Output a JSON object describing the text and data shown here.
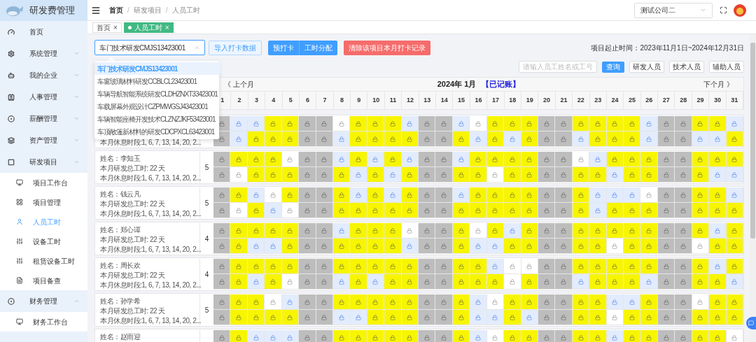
{
  "sidebar": {
    "title": "研发费管理",
    "items": [
      {
        "label": "首页",
        "kind": "link"
      },
      {
        "label": "系统管理",
        "kind": "group",
        "expanded": false
      },
      {
        "label": "我的企业",
        "kind": "group",
        "expanded": false
      },
      {
        "label": "人事管理",
        "kind": "group",
        "expanded": false
      },
      {
        "label": "薪酬管理",
        "kind": "group",
        "expanded": false
      },
      {
        "label": "资产管理",
        "kind": "group",
        "expanded": false
      },
      {
        "label": "研发项目",
        "kind": "group",
        "expanded": true,
        "children": [
          {
            "label": "项目工作台",
            "selected": false
          },
          {
            "label": "项目管理",
            "selected": false
          },
          {
            "label": "人员工时",
            "selected": true
          },
          {
            "label": "设备工时",
            "selected": false
          },
          {
            "label": "租赁设备工时",
            "selected": false
          },
          {
            "label": "项目备查",
            "selected": false
          }
        ]
      },
      {
        "label": "财务管理",
        "kind": "group",
        "expanded": true,
        "children": [
          {
            "label": "财务工作台",
            "selected": false
          }
        ]
      }
    ]
  },
  "header": {
    "breadcrumb": [
      "首页",
      "研发项目",
      "人员工时"
    ],
    "separators": [
      "/",
      "/"
    ],
    "company": "测试公司二"
  },
  "tabs": [
    {
      "label": "首页",
      "close": "×",
      "selected": false
    },
    {
      "label": "人员工时",
      "close": "×",
      "selected": true
    }
  ],
  "toolbar": {
    "project": "车门技术研发CMJS13423001",
    "buttons": [
      {
        "label": "导入打卡数据",
        "kind": "outline"
      },
      {
        "label": "预打卡",
        "kind": "primary"
      },
      {
        "label": "工时分配",
        "kind": "primary"
      },
      {
        "label": "清除该项目本月打卡记录",
        "kind": "danger"
      }
    ],
    "period": "项目起止时间：2023年11月1日~2024年12月31日"
  },
  "dropdown": {
    "options": [
      {
        "label": "车门技术研发CMJS13423001",
        "selected": true
      },
      {
        "label": "车窗玻璃材料研发CCBLCL23423001",
        "selected": false
      },
      {
        "label": "车辆导航智能系统研发CLDHZNXT33423001",
        "selected": false
      },
      {
        "label": "车载屏幕外观设计CZPMWGSJ43423001",
        "selected": false
      },
      {
        "label": "车辆智能座椅开发技术CLZNZJKF53423001",
        "selected": false
      },
      {
        "label": "车顶敞篷新材料的研发CDCPXCL63423001",
        "selected": false
      }
    ]
  },
  "search": {
    "placeholder": "请输入员工姓名或工号",
    "button": "查询",
    "filters": [
      "研发人员",
      "技术人员",
      "辅助人员"
    ]
  },
  "calendar": {
    "prev": "《 上个月",
    "title": "2024年 1月",
    "status": "【已记账】",
    "next": "下个月 》",
    "days": [
      "1",
      "2",
      "3",
      "4",
      "5",
      "6",
      "7",
      "8",
      "9",
      "10",
      "11",
      "12",
      "13",
      "14",
      "15",
      "16",
      "17",
      "18",
      "19",
      "20",
      "21",
      "22",
      "23",
      "24",
      "25",
      "26",
      "27",
      "28",
      "29",
      "30",
      "31"
    ]
  },
  "employees": [
    {
      "rest": "本月休息时段:1, 6, 7, 13, 14, 20, 2...",
      "day_rows": [
        [
          {
            "kind": "rest"
          },
          {
            "kind": "open"
          },
          {
            "kind": "open"
          },
          {
            "kind": "work"
          },
          {
            "kind": "work"
          },
          {
            "kind": "rest"
          },
          {
            "kind": "rest"
          },
          {
            "kind": "empty"
          },
          {
            "kind": "work"
          },
          {
            "kind": "work"
          },
          {
            "kind": "work"
          },
          {
            "kind": "open"
          },
          {
            "kind": "rest"
          },
          {
            "kind": "rest"
          },
          {
            "kind": "open"
          },
          {
            "kind": "empty"
          },
          {
            "kind": "work"
          },
          {
            "kind": "work"
          },
          {
            "kind": "work"
          },
          {
            "kind": "rest"
          },
          {
            "kind": "rest"
          },
          {
            "kind": "work"
          },
          {
            "kind": "work"
          },
          {
            "kind": "work"
          },
          {
            "kind": "work"
          },
          {
            "kind": "open"
          },
          {
            "kind": "rest"
          },
          {
            "kind": "rest"
          },
          {
            "kind": "work"
          },
          {
            "kind": "work"
          },
          {
            "kind": "open"
          }
        ],
        [
          {
            "kind": "rest"
          },
          {
            "kind": "open"
          },
          {
            "kind": "work"
          },
          {
            "kind": "work"
          },
          {
            "kind": "work"
          },
          {
            "kind": "rest"
          },
          {
            "kind": "rest"
          },
          {
            "kind": "open"
          },
          {
            "kind": "work"
          },
          {
            "kind": "work"
          },
          {
            "kind": "work"
          },
          {
            "kind": "work"
          },
          {
            "kind": "rest"
          },
          {
            "kind": "rest"
          },
          {
            "kind": "work"
          },
          {
            "kind": "open"
          },
          {
            "kind": "work"
          },
          {
            "kind": "open"
          },
          {
            "kind": "work"
          },
          {
            "kind": "rest"
          },
          {
            "kind": "rest"
          },
          {
            "kind": "open"
          },
          {
            "kind": "work"
          },
          {
            "kind": "work"
          },
          {
            "kind": "work"
          },
          {
            "kind": "open"
          },
          {
            "kind": "rest"
          },
          {
            "kind": "rest"
          },
          {
            "kind": "open"
          },
          {
            "kind": "open"
          },
          {
            "kind": "work"
          }
        ]
      ]
    },
    {
      "name": "姓名：李知玉",
      "hours": "本月研发总工时: 22 天",
      "rest": "本月休息时段:1, 6, 7, 13, 14, 20, 2...",
      "count": "5",
      "day_rows": [
        [
          {
            "kind": "rest"
          },
          {
            "kind": "work"
          },
          {
            "kind": "work"
          },
          {
            "kind": "work"
          },
          {
            "kind": "empty"
          },
          {
            "kind": "rest"
          },
          {
            "kind": "rest"
          },
          {
            "kind": "open"
          },
          {
            "kind": "work"
          },
          {
            "kind": "open"
          },
          {
            "kind": "work"
          },
          {
            "kind": "open"
          },
          {
            "kind": "rest"
          },
          {
            "kind": "rest"
          },
          {
            "kind": "open"
          },
          {
            "kind": "work"
          },
          {
            "kind": "work"
          },
          {
            "kind": "work"
          },
          {
            "kind": "work"
          },
          {
            "kind": "rest"
          },
          {
            "kind": "rest"
          },
          {
            "kind": "empty"
          },
          {
            "kind": "open"
          },
          {
            "kind": "work"
          },
          {
            "kind": "work"
          },
          {
            "kind": "work"
          },
          {
            "kind": "rest"
          },
          {
            "kind": "rest"
          },
          {
            "kind": "work"
          },
          {
            "kind": "work"
          },
          {
            "kind": "work"
          }
        ],
        [
          {
            "kind": "rest"
          },
          {
            "kind": "empty"
          },
          {
            "kind": "work"
          },
          {
            "kind": "work"
          },
          {
            "kind": "work"
          },
          {
            "kind": "rest"
          },
          {
            "kind": "rest"
          },
          {
            "kind": "work"
          },
          {
            "kind": "open"
          },
          {
            "kind": "work"
          },
          {
            "kind": "open"
          },
          {
            "kind": "work"
          },
          {
            "kind": "rest"
          },
          {
            "kind": "rest"
          },
          {
            "kind": "work"
          },
          {
            "kind": "work"
          },
          {
            "kind": "empty"
          },
          {
            "kind": "work"
          },
          {
            "kind": "work"
          },
          {
            "kind": "rest"
          },
          {
            "kind": "rest"
          },
          {
            "kind": "work"
          },
          {
            "kind": "work"
          },
          {
            "kind": "open"
          },
          {
            "kind": "work"
          },
          {
            "kind": "work"
          },
          {
            "kind": "rest"
          },
          {
            "kind": "rest"
          },
          {
            "kind": "work"
          },
          {
            "kind": "open"
          },
          {
            "kind": "open"
          }
        ]
      ]
    },
    {
      "name": "姓名：钱云凡",
      "hours": "本月研发总工时: 22 天",
      "rest": "本月休息时段:1, 6, 7, 13, 14, 20, 2...",
      "count": "5",
      "day_rows": [
        [
          {
            "kind": "rest"
          },
          {
            "kind": "work"
          },
          {
            "kind": "open"
          },
          {
            "kind": "empty"
          },
          {
            "kind": "work"
          },
          {
            "kind": "rest"
          },
          {
            "kind": "rest"
          },
          {
            "kind": "work"
          },
          {
            "kind": "open"
          },
          {
            "kind": "work"
          },
          {
            "kind": "open"
          },
          {
            "kind": "work"
          },
          {
            "kind": "rest"
          },
          {
            "kind": "rest"
          },
          {
            "kind": "open"
          },
          {
            "kind": "work"
          },
          {
            "kind": "work"
          },
          {
            "kind": "work"
          },
          {
            "kind": "work"
          },
          {
            "kind": "rest"
          },
          {
            "kind": "rest"
          },
          {
            "kind": "work"
          },
          {
            "kind": "open"
          },
          {
            "kind": "open"
          },
          {
            "kind": "open"
          },
          {
            "kind": "empty"
          },
          {
            "kind": "rest"
          },
          {
            "kind": "rest"
          },
          {
            "kind": "work"
          },
          {
            "kind": "work"
          },
          {
            "kind": "open"
          }
        ],
        [
          {
            "kind": "rest"
          },
          {
            "kind": "empty"
          },
          {
            "kind": "work"
          },
          {
            "kind": "open"
          },
          {
            "kind": "empty"
          },
          {
            "kind": "rest"
          },
          {
            "kind": "rest"
          },
          {
            "kind": "work"
          },
          {
            "kind": "work"
          },
          {
            "kind": "work"
          },
          {
            "kind": "work"
          },
          {
            "kind": "work"
          },
          {
            "kind": "rest"
          },
          {
            "kind": "rest"
          },
          {
            "kind": "work"
          },
          {
            "kind": "work"
          },
          {
            "kind": "work"
          },
          {
            "kind": "work"
          },
          {
            "kind": "work"
          },
          {
            "kind": "rest"
          },
          {
            "kind": "rest"
          },
          {
            "kind": "work"
          },
          {
            "kind": "open"
          },
          {
            "kind": "work"
          },
          {
            "kind": "work"
          },
          {
            "kind": "work"
          },
          {
            "kind": "rest"
          },
          {
            "kind": "rest"
          },
          {
            "kind": "work"
          },
          {
            "kind": "work"
          },
          {
            "kind": "work"
          }
        ]
      ]
    },
    {
      "name": "姓名：郑心谭",
      "hours": "本月研发总工时: 22 天",
      "rest": "本月休息时段:1, 6, 7, 13, 14, 20, 2...",
      "count": "4",
      "day_rows": [
        [
          {
            "kind": "rest"
          },
          {
            "kind": "work"
          },
          {
            "kind": "work"
          },
          {
            "kind": "work"
          },
          {
            "kind": "work"
          },
          {
            "kind": "rest"
          },
          {
            "kind": "rest"
          },
          {
            "kind": "open"
          },
          {
            "kind": "work"
          },
          {
            "kind": "work"
          },
          {
            "kind": "work"
          },
          {
            "kind": "empty"
          },
          {
            "kind": "rest"
          },
          {
            "kind": "rest"
          },
          {
            "kind": "work"
          },
          {
            "kind": "empty"
          },
          {
            "kind": "work"
          },
          {
            "kind": "open"
          },
          {
            "kind": "work"
          },
          {
            "kind": "rest"
          },
          {
            "kind": "rest"
          },
          {
            "kind": "work"
          },
          {
            "kind": "work"
          },
          {
            "kind": "work"
          },
          {
            "kind": "work"
          },
          {
            "kind": "work"
          },
          {
            "kind": "rest"
          },
          {
            "kind": "rest"
          },
          {
            "kind": "work"
          },
          {
            "kind": "open"
          },
          {
            "kind": "work"
          }
        ],
        [
          {
            "kind": "rest"
          },
          {
            "kind": "work"
          },
          {
            "kind": "open"
          },
          {
            "kind": "open"
          },
          {
            "kind": "work"
          },
          {
            "kind": "rest"
          },
          {
            "kind": "rest"
          },
          {
            "kind": "work"
          },
          {
            "kind": "work"
          },
          {
            "kind": "work"
          },
          {
            "kind": "work"
          },
          {
            "kind": "open"
          },
          {
            "kind": "rest"
          },
          {
            "kind": "rest"
          },
          {
            "kind": "work"
          },
          {
            "kind": "open"
          },
          {
            "kind": "open"
          },
          {
            "kind": "work"
          },
          {
            "kind": "work"
          },
          {
            "kind": "rest"
          },
          {
            "kind": "rest"
          },
          {
            "kind": "work"
          },
          {
            "kind": "work"
          },
          {
            "kind": "empty"
          },
          {
            "kind": "work"
          },
          {
            "kind": "work"
          },
          {
            "kind": "rest"
          },
          {
            "kind": "rest"
          },
          {
            "kind": "empty"
          },
          {
            "kind": "work"
          },
          {
            "kind": "work"
          }
        ]
      ]
    },
    {
      "name": "姓名：周长欢",
      "hours": "本月研发总工时: 22 天",
      "rest": "本月休息时段:1, 6, 7, 13, 14, 20, 2...",
      "count": "4",
      "day_rows": [
        [
          {
            "kind": "rest"
          },
          {
            "kind": "work"
          },
          {
            "kind": "work"
          },
          {
            "kind": "work"
          },
          {
            "kind": "work"
          },
          {
            "kind": "rest"
          },
          {
            "kind": "rest"
          },
          {
            "kind": "work"
          },
          {
            "kind": "work"
          },
          {
            "kind": "work"
          },
          {
            "kind": "work"
          },
          {
            "kind": "work"
          },
          {
            "kind": "rest"
          },
          {
            "kind": "rest"
          },
          {
            "kind": "work"
          },
          {
            "kind": "work"
          },
          {
            "kind": "open"
          },
          {
            "kind": "empty"
          },
          {
            "kind": "empty"
          },
          {
            "kind": "rest"
          },
          {
            "kind": "rest"
          },
          {
            "kind": "work"
          },
          {
            "kind": "work"
          },
          {
            "kind": "work"
          },
          {
            "kind": "work"
          },
          {
            "kind": "work"
          },
          {
            "kind": "rest"
          },
          {
            "kind": "rest"
          },
          {
            "kind": "work"
          },
          {
            "kind": "open"
          },
          {
            "kind": "work"
          }
        ],
        [
          {
            "kind": "rest"
          },
          {
            "kind": "work"
          },
          {
            "kind": "open"
          },
          {
            "kind": "work"
          },
          {
            "kind": "empty"
          },
          {
            "kind": "rest"
          },
          {
            "kind": "rest"
          },
          {
            "kind": "open"
          },
          {
            "kind": "work"
          },
          {
            "kind": "open"
          },
          {
            "kind": "work"
          },
          {
            "kind": "work"
          },
          {
            "kind": "rest"
          },
          {
            "kind": "rest"
          },
          {
            "kind": "work"
          },
          {
            "kind": "work"
          },
          {
            "kind": "work"
          },
          {
            "kind": "empty"
          },
          {
            "kind": "work"
          },
          {
            "kind": "rest"
          },
          {
            "kind": "rest"
          },
          {
            "kind": "open"
          },
          {
            "kind": "work"
          },
          {
            "kind": "work"
          },
          {
            "kind": "work"
          },
          {
            "kind": "open"
          },
          {
            "kind": "rest"
          },
          {
            "kind": "rest"
          },
          {
            "kind": "work"
          },
          {
            "kind": "work"
          },
          {
            "kind": "open"
          }
        ]
      ]
    },
    {
      "name": "姓名：孙学希",
      "hours": "本月研发总工时: 22 天",
      "rest": "本月休息时段:1, 6, 7, 13, 14, 20, 2...",
      "count": "5",
      "day_rows": [
        [
          {
            "kind": "rest"
          },
          {
            "kind": "work"
          },
          {
            "kind": "work"
          },
          {
            "kind": "empty"
          },
          {
            "kind": "open"
          },
          {
            "kind": "rest"
          },
          {
            "kind": "rest"
          },
          {
            "kind": "work"
          },
          {
            "kind": "work"
          },
          {
            "kind": "work"
          },
          {
            "kind": "work"
          },
          {
            "kind": "work"
          },
          {
            "kind": "rest"
          },
          {
            "kind": "rest"
          },
          {
            "kind": "work"
          },
          {
            "kind": "open"
          },
          {
            "kind": "empty"
          },
          {
            "kind": "work"
          },
          {
            "kind": "work"
          },
          {
            "kind": "rest"
          },
          {
            "kind": "rest"
          },
          {
            "kind": "work"
          },
          {
            "kind": "work"
          },
          {
            "kind": "open"
          },
          {
            "kind": "open"
          },
          {
            "kind": "work"
          },
          {
            "kind": "rest"
          },
          {
            "kind": "rest"
          },
          {
            "kind": "empty"
          },
          {
            "kind": "work"
          },
          {
            "kind": "work"
          }
        ],
        [
          {
            "kind": "rest"
          },
          {
            "kind": "work"
          },
          {
            "kind": "work"
          },
          {
            "kind": "work"
          },
          {
            "kind": "work"
          },
          {
            "kind": "rest"
          },
          {
            "kind": "rest"
          },
          {
            "kind": "open"
          },
          {
            "kind": "open"
          },
          {
            "kind": "work"
          },
          {
            "kind": "work"
          },
          {
            "kind": "work"
          },
          {
            "kind": "rest"
          },
          {
            "kind": "rest"
          },
          {
            "kind": "work"
          },
          {
            "kind": "open"
          },
          {
            "kind": "open"
          },
          {
            "kind": "work"
          },
          {
            "kind": "open"
          },
          {
            "kind": "rest"
          },
          {
            "kind": "rest"
          },
          {
            "kind": "work"
          },
          {
            "kind": "work"
          },
          {
            "kind": "empty"
          },
          {
            "kind": "work"
          },
          {
            "kind": "work"
          },
          {
            "kind": "rest"
          },
          {
            "kind": "rest"
          },
          {
            "kind": "work"
          },
          {
            "kind": "work"
          },
          {
            "kind": "work"
          }
        ]
      ]
    },
    {
      "name": "姓名：赵雨迎",
      "day_rows": [
        [
          {
            "kind": "rest"
          },
          {
            "kind": "work"
          },
          {
            "kind": "open"
          },
          {
            "kind": "open"
          },
          {
            "kind": "open"
          },
          {
            "kind": "rest"
          },
          {
            "kind": "rest"
          },
          {
            "kind": "work"
          },
          {
            "kind": "work"
          },
          {
            "kind": "work"
          },
          {
            "kind": "work"
          },
          {
            "kind": "work"
          },
          {
            "kind": "rest"
          },
          {
            "kind": "rest"
          },
          {
            "kind": "work"
          },
          {
            "kind": "open"
          },
          {
            "kind": "empty"
          },
          {
            "kind": "work"
          },
          {
            "kind": "work"
          },
          {
            "kind": "rest"
          },
          {
            "kind": "rest"
          },
          {
            "kind": "work"
          },
          {
            "kind": "work"
          },
          {
            "kind": "open"
          },
          {
            "kind": "work"
          },
          {
            "kind": "work"
          },
          {
            "kind": "rest"
          },
          {
            "kind": "rest"
          },
          {
            "kind": "work"
          },
          {
            "kind": "work"
          },
          {
            "kind": "empty"
          }
        ]
      ]
    }
  ]
}
